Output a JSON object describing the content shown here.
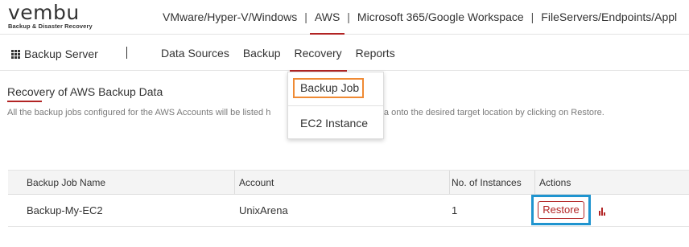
{
  "brand": {
    "logo_text": "vembu",
    "tagline": "Backup & Disaster Recovery"
  },
  "top_nav": {
    "items": [
      {
        "label": "VMware/Hyper-V/Windows",
        "active": false
      },
      {
        "label": "AWS",
        "active": true
      },
      {
        "label": "Microsoft 365/Google Workspace",
        "active": false
      },
      {
        "label": "FileServers/Endpoints/Appl",
        "active": false
      }
    ],
    "separator": "|"
  },
  "sub_nav": {
    "server_label": "Backup Server",
    "server_icon": "apps-grid-icon",
    "items": [
      {
        "label": "Data Sources",
        "active": false
      },
      {
        "label": "Backup",
        "active": false
      },
      {
        "label": "Recovery",
        "active": true
      },
      {
        "label": "Reports",
        "active": false
      }
    ]
  },
  "recovery_menu": {
    "items": [
      {
        "label": "Backup Job",
        "highlighted": true
      },
      {
        "label": "EC2 Instance",
        "highlighted": false
      }
    ]
  },
  "page": {
    "title": "Recovery of AWS Backup Data",
    "description_left": "All the backup jobs configured for the AWS Accounts will be listed h",
    "description_right": "ne data onto the desired target location by clicking on Restore."
  },
  "table": {
    "columns": [
      "Backup Job Name",
      "Account",
      "No. of Instances",
      "Actions"
    ],
    "rows": [
      {
        "job_name": "Backup-My-EC2",
        "account": "UnixArena",
        "instances": "1",
        "action_label": "Restore",
        "report_icon": "bar-chart-icon"
      }
    ]
  },
  "colors": {
    "accent": "#b22424",
    "menu_highlight": "#ef8a34",
    "action_highlight": "#1f94cf"
  }
}
